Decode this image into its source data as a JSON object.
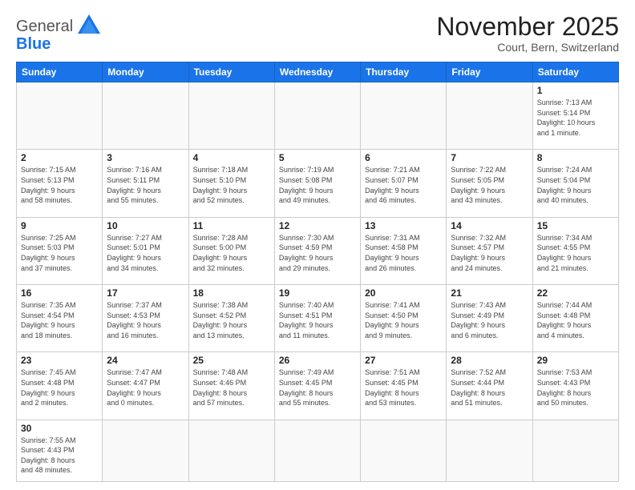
{
  "header": {
    "logo_general": "General",
    "logo_blue": "Blue",
    "title": "November 2025",
    "location": "Court, Bern, Switzerland"
  },
  "weekdays": [
    "Sunday",
    "Monday",
    "Tuesday",
    "Wednesday",
    "Thursday",
    "Friday",
    "Saturday"
  ],
  "weeks": [
    [
      {
        "day": "",
        "info": ""
      },
      {
        "day": "",
        "info": ""
      },
      {
        "day": "",
        "info": ""
      },
      {
        "day": "",
        "info": ""
      },
      {
        "day": "",
        "info": ""
      },
      {
        "day": "",
        "info": ""
      },
      {
        "day": "1",
        "info": "Sunrise: 7:13 AM\nSunset: 5:14 PM\nDaylight: 10 hours\nand 1 minute."
      }
    ],
    [
      {
        "day": "2",
        "info": "Sunrise: 7:15 AM\nSunset: 5:13 PM\nDaylight: 9 hours\nand 58 minutes."
      },
      {
        "day": "3",
        "info": "Sunrise: 7:16 AM\nSunset: 5:11 PM\nDaylight: 9 hours\nand 55 minutes."
      },
      {
        "day": "4",
        "info": "Sunrise: 7:18 AM\nSunset: 5:10 PM\nDaylight: 9 hours\nand 52 minutes."
      },
      {
        "day": "5",
        "info": "Sunrise: 7:19 AM\nSunset: 5:08 PM\nDaylight: 9 hours\nand 49 minutes."
      },
      {
        "day": "6",
        "info": "Sunrise: 7:21 AM\nSunset: 5:07 PM\nDaylight: 9 hours\nand 46 minutes."
      },
      {
        "day": "7",
        "info": "Sunrise: 7:22 AM\nSunset: 5:05 PM\nDaylight: 9 hours\nand 43 minutes."
      },
      {
        "day": "8",
        "info": "Sunrise: 7:24 AM\nSunset: 5:04 PM\nDaylight: 9 hours\nand 40 minutes."
      }
    ],
    [
      {
        "day": "9",
        "info": "Sunrise: 7:25 AM\nSunset: 5:03 PM\nDaylight: 9 hours\nand 37 minutes."
      },
      {
        "day": "10",
        "info": "Sunrise: 7:27 AM\nSunset: 5:01 PM\nDaylight: 9 hours\nand 34 minutes."
      },
      {
        "day": "11",
        "info": "Sunrise: 7:28 AM\nSunset: 5:00 PM\nDaylight: 9 hours\nand 32 minutes."
      },
      {
        "day": "12",
        "info": "Sunrise: 7:30 AM\nSunset: 4:59 PM\nDaylight: 9 hours\nand 29 minutes."
      },
      {
        "day": "13",
        "info": "Sunrise: 7:31 AM\nSunset: 4:58 PM\nDaylight: 9 hours\nand 26 minutes."
      },
      {
        "day": "14",
        "info": "Sunrise: 7:32 AM\nSunset: 4:57 PM\nDaylight: 9 hours\nand 24 minutes."
      },
      {
        "day": "15",
        "info": "Sunrise: 7:34 AM\nSunset: 4:55 PM\nDaylight: 9 hours\nand 21 minutes."
      }
    ],
    [
      {
        "day": "16",
        "info": "Sunrise: 7:35 AM\nSunset: 4:54 PM\nDaylight: 9 hours\nand 18 minutes."
      },
      {
        "day": "17",
        "info": "Sunrise: 7:37 AM\nSunset: 4:53 PM\nDaylight: 9 hours\nand 16 minutes."
      },
      {
        "day": "18",
        "info": "Sunrise: 7:38 AM\nSunset: 4:52 PM\nDaylight: 9 hours\nand 13 minutes."
      },
      {
        "day": "19",
        "info": "Sunrise: 7:40 AM\nSunset: 4:51 PM\nDaylight: 9 hours\nand 11 minutes."
      },
      {
        "day": "20",
        "info": "Sunrise: 7:41 AM\nSunset: 4:50 PM\nDaylight: 9 hours\nand 9 minutes."
      },
      {
        "day": "21",
        "info": "Sunrise: 7:43 AM\nSunset: 4:49 PM\nDaylight: 9 hours\nand 6 minutes."
      },
      {
        "day": "22",
        "info": "Sunrise: 7:44 AM\nSunset: 4:48 PM\nDaylight: 9 hours\nand 4 minutes."
      }
    ],
    [
      {
        "day": "23",
        "info": "Sunrise: 7:45 AM\nSunset: 4:48 PM\nDaylight: 9 hours\nand 2 minutes."
      },
      {
        "day": "24",
        "info": "Sunrise: 7:47 AM\nSunset: 4:47 PM\nDaylight: 9 hours\nand 0 minutes."
      },
      {
        "day": "25",
        "info": "Sunrise: 7:48 AM\nSunset: 4:46 PM\nDaylight: 8 hours\nand 57 minutes."
      },
      {
        "day": "26",
        "info": "Sunrise: 7:49 AM\nSunset: 4:45 PM\nDaylight: 8 hours\nand 55 minutes."
      },
      {
        "day": "27",
        "info": "Sunrise: 7:51 AM\nSunset: 4:45 PM\nDaylight: 8 hours\nand 53 minutes."
      },
      {
        "day": "28",
        "info": "Sunrise: 7:52 AM\nSunset: 4:44 PM\nDaylight: 8 hours\nand 51 minutes."
      },
      {
        "day": "29",
        "info": "Sunrise: 7:53 AM\nSunset: 4:43 PM\nDaylight: 8 hours\nand 50 minutes."
      }
    ],
    [
      {
        "day": "30",
        "info": "Sunrise: 7:55 AM\nSunset: 4:43 PM\nDaylight: 8 hours\nand 48 minutes."
      },
      {
        "day": "",
        "info": ""
      },
      {
        "day": "",
        "info": ""
      },
      {
        "day": "",
        "info": ""
      },
      {
        "day": "",
        "info": ""
      },
      {
        "day": "",
        "info": ""
      },
      {
        "day": "",
        "info": ""
      }
    ]
  ]
}
